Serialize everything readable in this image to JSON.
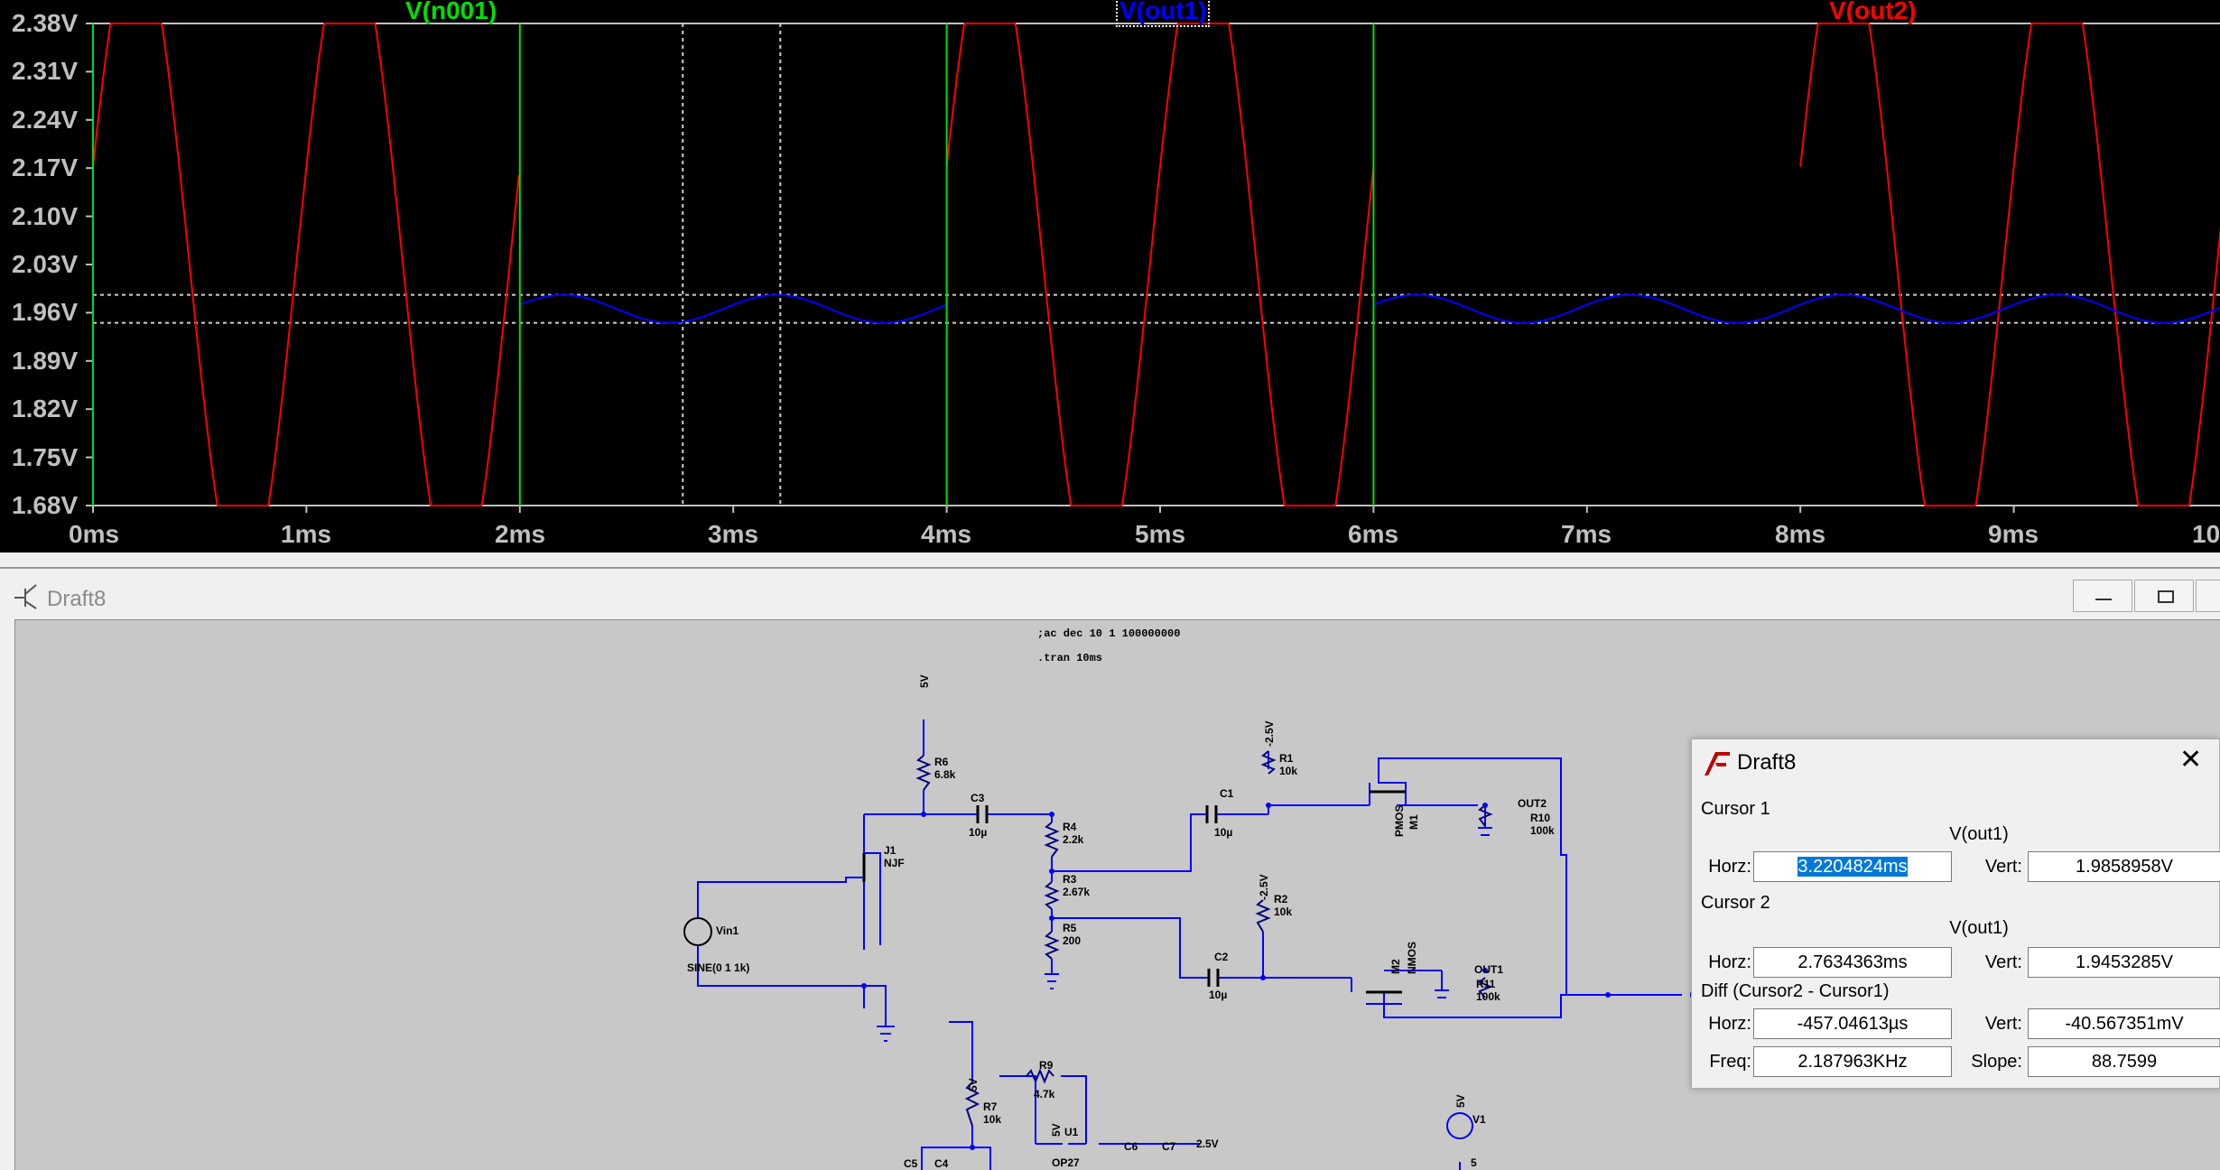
{
  "plot": {
    "traces": [
      {
        "name": "V(n001)",
        "color": "#00e000"
      },
      {
        "name": "V(out1)",
        "color": "#0000ff"
      },
      {
        "name": "V(out2)",
        "color": "#ff0000"
      }
    ],
    "y_ticks": [
      "2.38V",
      "2.31V",
      "2.24V",
      "2.17V",
      "2.10V",
      "2.03V",
      "1.96V",
      "1.89V",
      "1.82V",
      "1.75V",
      "1.68V"
    ],
    "x_ticks": [
      "0ms",
      "1ms",
      "2ms",
      "3ms",
      "4ms",
      "5ms",
      "6ms",
      "7ms",
      "8ms",
      "9ms",
      "10"
    ],
    "cursor_x_ms": [
      2.7634363,
      3.2204824
    ],
    "cursor_y_v": [
      1.9453285,
      1.9858958
    ]
  },
  "schematic": {
    "title": "Draft8",
    "directives": [
      ";ac dec 10 1 100000000",
      ".tran 10ms"
    ],
    "components": {
      "r6": {
        "name": "R6",
        "value": "6.8k"
      },
      "c3": {
        "name": "C3",
        "value": "10µ"
      },
      "j1": {
        "name": "J1",
        "value": "NJF"
      },
      "vin1": {
        "name": "Vin1",
        "value": "SINE(0 1 1k)"
      },
      "r4": {
        "name": "R4",
        "value": "2.2k"
      },
      "r3": {
        "name": "R3",
        "value": "2.67k"
      },
      "r5": {
        "name": "R5",
        "value": "200"
      },
      "c1": {
        "name": "C1",
        "value": "10µ"
      },
      "c2": {
        "name": "C2",
        "value": "10µ"
      },
      "r1": {
        "name": "R1",
        "value": "10k"
      },
      "r2": {
        "name": "R2",
        "value": "10k"
      },
      "m1": {
        "name": "M1",
        "value": "PMOS"
      },
      "m2": {
        "name": "M2",
        "value": "NMOS"
      },
      "r10": {
        "name": "R10",
        "value": "100k"
      },
      "r11": {
        "name": "R11",
        "value": "100k"
      },
      "r9": {
        "name": "R9",
        "value": "4.7k"
      },
      "r7": {
        "name": "R7",
        "value": "10k"
      },
      "u1": {
        "name": "U1",
        "value": "OP27"
      },
      "v1": {
        "name": "V1",
        "value": "5"
      },
      "c5": {
        "name": "C5"
      },
      "c4": {
        "name": "C4"
      },
      "c6": {
        "name": "C6"
      },
      "c7": {
        "name": "C7"
      }
    },
    "nets": {
      "5v": "5V",
      "n2_5v": "-2.5V",
      "p2_5v": "2.5V",
      "out1": "OUT1",
      "out2": "OUT2"
    }
  },
  "dialog": {
    "title": "Draft8",
    "cursor1": {
      "section": "Cursor 1",
      "trace": "V(out1)",
      "horz_label": "Horz:",
      "horz": "3.2204824ms",
      "vert_label": "Vert:",
      "vert": "1.9858958V"
    },
    "cursor2": {
      "section": "Cursor 2",
      "trace": "V(out1)",
      "horz_label": "Horz:",
      "horz": "2.7634363ms",
      "vert_label": "Vert:",
      "vert": "1.9453285V"
    },
    "diff": {
      "section": "Diff (Cursor2 - Cursor1)",
      "horz_label": "Horz:",
      "horz": "-457.04613µs",
      "vert_label": "Vert:",
      "vert": "-40.567351mV",
      "freq_label": "Freq:",
      "freq": "2.187963KHz",
      "slope_label": "Slope:",
      "slope": "88.7599"
    }
  }
}
